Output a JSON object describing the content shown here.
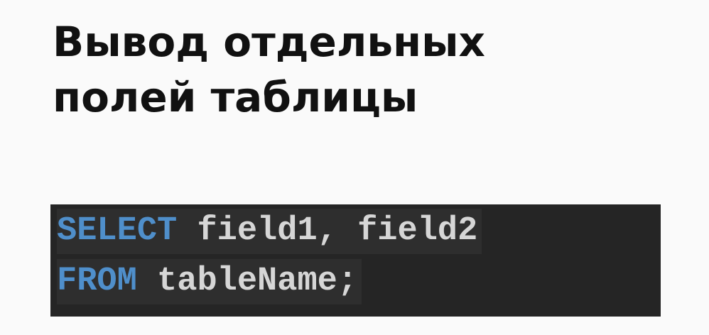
{
  "title": {
    "line1": "Вывод отдельных",
    "line2": "полей таблицы"
  },
  "code": {
    "line1": {
      "keyword": "SELECT",
      "rest": " field1, field2"
    },
    "line2": {
      "keyword": "FROM",
      "rest": " tableName;"
    }
  },
  "colors": {
    "background": "#fafafa",
    "code_background": "#252525",
    "keyword": "#4f8fcb",
    "code_text": "#d6d6d6",
    "title_text": "#111111"
  }
}
